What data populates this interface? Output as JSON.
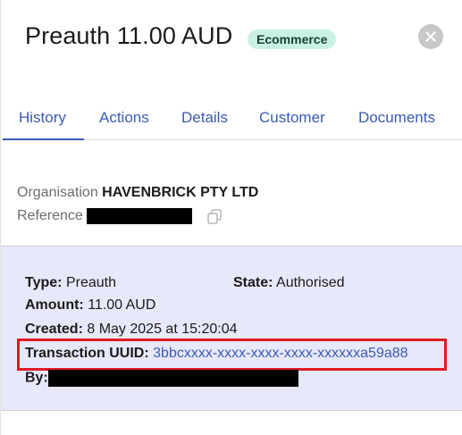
{
  "header": {
    "title": "Preauth 11.00 AUD",
    "badge": "Ecommerce"
  },
  "tabs": [
    {
      "label": "History",
      "active": true
    },
    {
      "label": "Actions",
      "active": false
    },
    {
      "label": "Details",
      "active": false
    },
    {
      "label": "Customer",
      "active": false
    },
    {
      "label": "Documents",
      "active": false
    }
  ],
  "organisation": {
    "org_label": "Organisation",
    "org_value": "HAVENBRICK PTY LTD",
    "ref_label": "Reference"
  },
  "details": {
    "type_label": "Type:",
    "type_value": "Preauth",
    "state_label": "State:",
    "state_value": "Authorised",
    "amount_label": "Amount:",
    "amount_value": "11.00 AUD",
    "created_label": "Created:",
    "created_value": "8 May 2025 at 15:20:04",
    "uuid_label": "Transaction UUID:",
    "uuid_value": "3bbcxxxx-xxxx-xxxx-xxxx-xxxxxxa59a88",
    "by_label": "By:"
  },
  "colors": {
    "accent": "#3c5ab4",
    "badge_bg": "#c9f1e2",
    "details_bg": "#e8e8fb",
    "highlight": "#e01b24"
  },
  "icons": {
    "close": "close-icon",
    "copy": "copy-icon"
  }
}
